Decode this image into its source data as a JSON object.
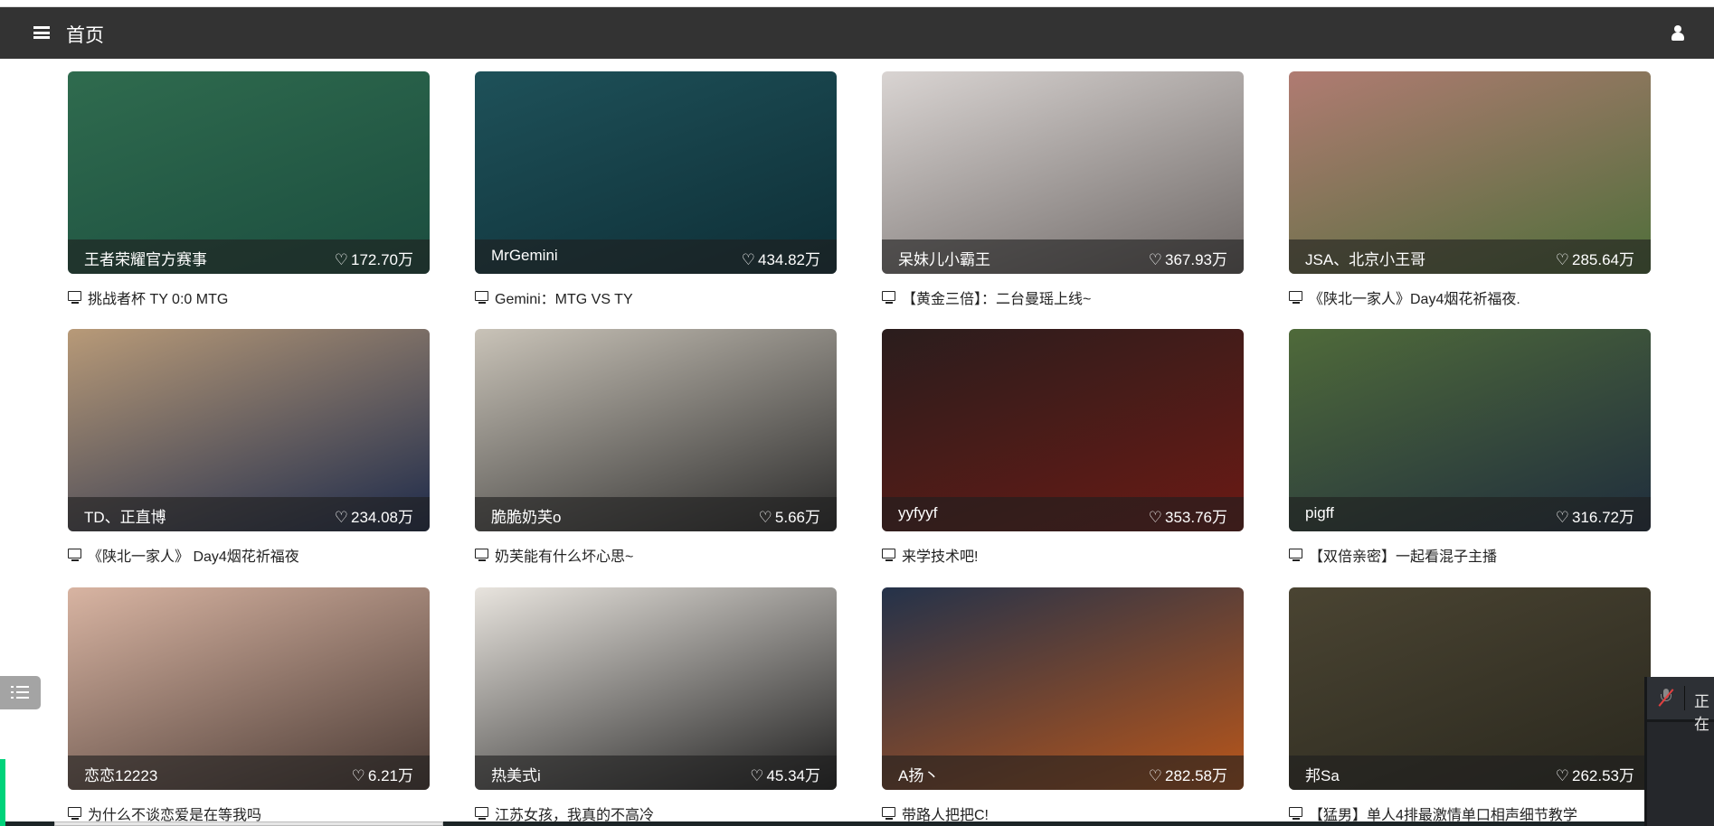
{
  "header": {
    "title": "首页",
    "menu_icon": "menu-icon",
    "user_icon": "user-icon"
  },
  "cards": [
    {
      "anchor": "王者荣耀官方赛事",
      "likes": "172.70万",
      "title": "挑战者杯 TY 0:0 MTG",
      "thumb_colors": [
        "#2f6b4e",
        "#1b4d3f"
      ]
    },
    {
      "anchor": "MrGemini",
      "likes": "434.82万",
      "title": "Gemini：MTG VS TY",
      "thumb_colors": [
        "#1e5159",
        "#0e2e36"
      ]
    },
    {
      "anchor": "呆妹儿小霸王",
      "likes": "367.93万",
      "title": "【黄金三倍】：二台曼瑶上线~",
      "thumb_colors": [
        "#d9d4d2",
        "#6e6866"
      ]
    },
    {
      "anchor": "JSA、北京小王哥",
      "likes": "285.64万",
      "title": "《陕北一家人》Day4烟花祈福夜.",
      "thumb_colors": [
        "#b07b72",
        "#4f6e3a"
      ]
    },
    {
      "anchor": "TD、正直博",
      "likes": "234.08万",
      "title": "《陕北一家人》 Day4烟花祈福夜",
      "thumb_colors": [
        "#b89a78",
        "#1d2a4a"
      ]
    },
    {
      "anchor": "脆脆奶芙o",
      "likes": "5.66万",
      "title": "奶芙能有什么坏心思~",
      "thumb_colors": [
        "#c9c3b8",
        "#2a2a2a"
      ]
    },
    {
      "anchor": "yyfyyf",
      "likes": "353.76万",
      "title": "来学技术吧!",
      "thumb_colors": [
        "#2a1d1d",
        "#6b1a14"
      ]
    },
    {
      "anchor": "pigff",
      "likes": "316.72万",
      "title": "【双倍亲密】一起看混子主播",
      "thumb_colors": [
        "#4f6a3a",
        "#1f2d3d"
      ]
    },
    {
      "anchor": "恋恋12223",
      "likes": "6.21万",
      "title": "为什么不谈恋爱是在等我吗",
      "thumb_colors": [
        "#d8b4a2",
        "#4a3a34"
      ]
    },
    {
      "anchor": "热美式i",
      "likes": "45.34万",
      "title": "江苏女孩，我真的不高冷",
      "thumb_colors": [
        "#e8e4de",
        "#1e1e1e"
      ]
    },
    {
      "anchor": "A扬丶",
      "likes": "282.58万",
      "title": "带路人把把C!",
      "thumb_colors": [
        "#24324a",
        "#b9561a"
      ]
    },
    {
      "anchor": "邦Sa",
      "likes": "262.53万",
      "title": "【猛男】单人4排最激情单口相声细节教学",
      "thumb_colors": [
        "#4a4432",
        "#2a281e"
      ]
    }
  ],
  "panel": {
    "text": "正在"
  },
  "colors": {
    "header_bg": "#333333",
    "accent_green": "#00d37a"
  }
}
